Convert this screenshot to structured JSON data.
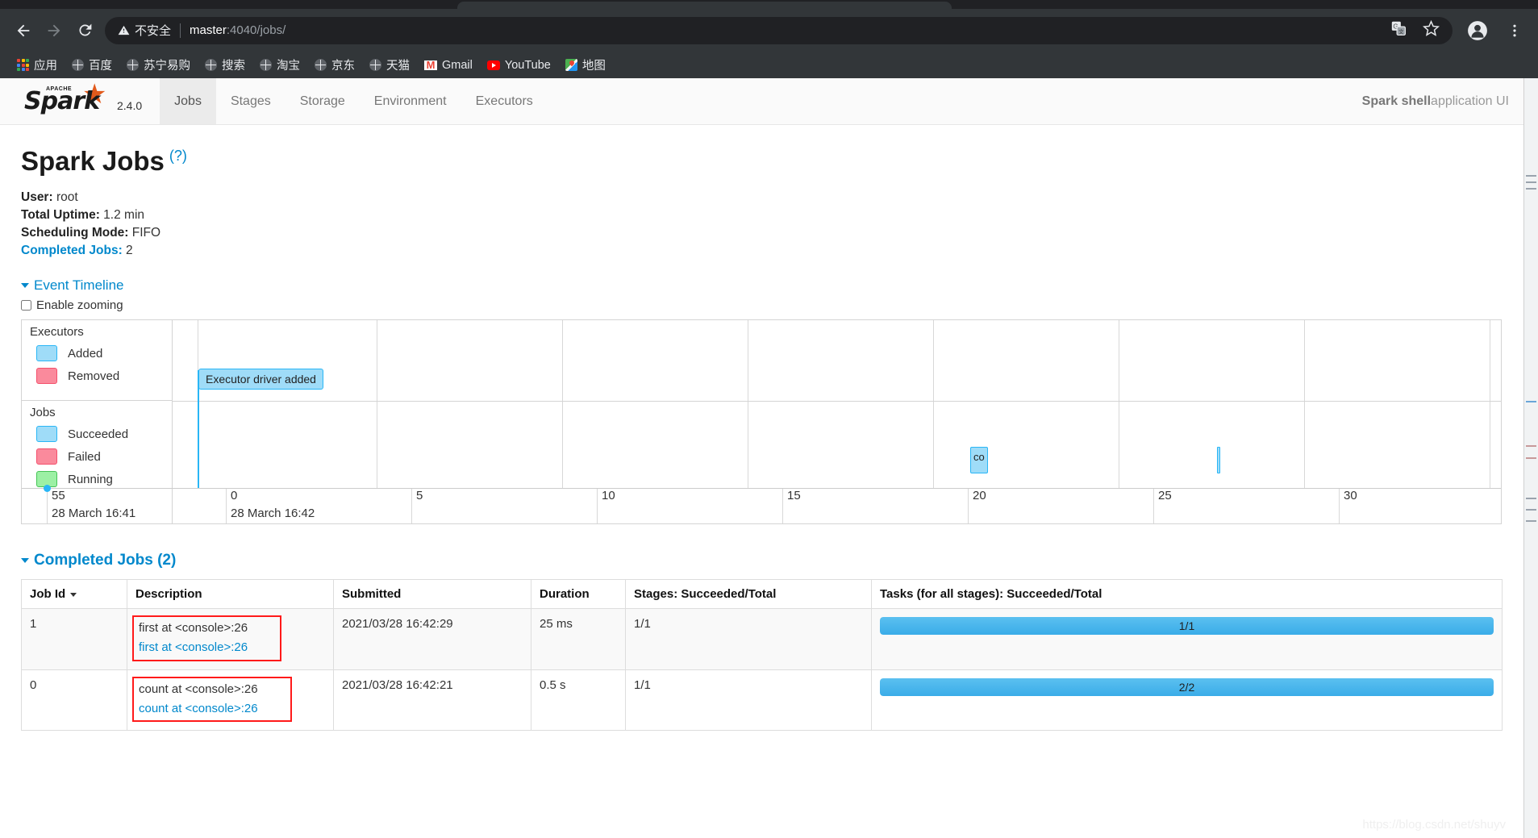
{
  "browser": {
    "back_icon": "back-arrow-icon",
    "forward_icon": "forward-arrow-icon",
    "reload_icon": "reload-icon",
    "security_label": "不安全",
    "security_icon": "warning-triangle-icon",
    "url_host": "master",
    "url_rest": ":4040/jobs/",
    "url_full": "master:4040/jobs/",
    "translate_icon": "translate-icon",
    "bookmark_icon": "star-icon",
    "profile_icon": "account-avatar-icon",
    "menu_icon": "three-dot-menu-icon",
    "bookmarks": [
      {
        "label": "应用",
        "icon": "apps-grid-icon"
      },
      {
        "label": "百度",
        "icon": "globe-icon"
      },
      {
        "label": "苏宁易购",
        "icon": "globe-icon"
      },
      {
        "label": "搜索",
        "icon": "globe-icon"
      },
      {
        "label": "淘宝",
        "icon": "globe-icon"
      },
      {
        "label": "京东",
        "icon": "globe-icon"
      },
      {
        "label": "天猫",
        "icon": "globe-icon"
      },
      {
        "label": "Gmail",
        "icon": "gmail-icon"
      },
      {
        "label": "YouTube",
        "icon": "youtube-icon"
      },
      {
        "label": "地图",
        "icon": "maps-icon"
      }
    ]
  },
  "spark_nav": {
    "brand_word": "Spark",
    "brand_tag": "APACHE",
    "version": "2.4.0",
    "tabs": [
      {
        "label": "Jobs",
        "active": true
      },
      {
        "label": "Stages",
        "active": false
      },
      {
        "label": "Storage",
        "active": false
      },
      {
        "label": "Environment",
        "active": false
      },
      {
        "label": "Executors",
        "active": false
      }
    ],
    "app_title_bold": "Spark shell",
    "app_title_rest": " application UI"
  },
  "page": {
    "title": "Spark Jobs",
    "help_link": "(?)",
    "summary": [
      {
        "label": "User:",
        "value": " root",
        "is_link": false
      },
      {
        "label": "Total Uptime:",
        "value": " 1.2 min",
        "is_link": false
      },
      {
        "label": "Scheduling Mode:",
        "value": " FIFO",
        "is_link": false
      },
      {
        "label": "Completed Jobs:",
        "value": " 2",
        "is_link": true
      }
    ],
    "event_timeline_label": "Event Timeline",
    "enable_zooming_label": "Enable zooming",
    "watermark": "https://blog.csdn.net/shuyv"
  },
  "timeline": {
    "legend": {
      "executors_title": "Executors",
      "executors_items": [
        {
          "label": "Added",
          "color": "#9fdcf8"
        },
        {
          "label": "Removed",
          "color": "#fa8a9c"
        }
      ],
      "jobs_title": "Jobs",
      "jobs_items": [
        {
          "label": "Succeeded",
          "color": "#9fdcf8"
        },
        {
          "label": "Failed",
          "color": "#fa8a9c"
        },
        {
          "label": "Running",
          "color": "#9cf0a4"
        }
      ]
    },
    "events": [
      {
        "label": "Executor driver added",
        "type": "executor-added"
      },
      {
        "label": "co",
        "type": "job-succeeded"
      },
      {
        "label": "",
        "type": "job-succeeded"
      }
    ],
    "axis_ticks": [
      {
        "num": "55",
        "date": "28 March 16:41"
      },
      {
        "num": "0",
        "date": "28 March 16:42"
      },
      {
        "num": "5",
        "date": ""
      },
      {
        "num": "10",
        "date": ""
      },
      {
        "num": "15",
        "date": ""
      },
      {
        "num": "20",
        "date": ""
      },
      {
        "num": "25",
        "date": ""
      },
      {
        "num": "30",
        "date": ""
      }
    ]
  },
  "jobs_section": {
    "heading": "Completed Jobs (2)",
    "columns": [
      "Job Id",
      "Description",
      "Submitted",
      "Duration",
      "Stages: Succeeded/Total",
      "Tasks (for all stages): Succeeded/Total"
    ],
    "rows": [
      {
        "job_id": "1",
        "desc_main": "first at <console>:26",
        "desc_link": "first at <console>:26",
        "submitted": "2021/03/28 16:42:29",
        "duration": "25 ms",
        "stages": "1/1",
        "tasks_text": "1/1",
        "tasks_pct": 100
      },
      {
        "job_id": "0",
        "desc_main": "count at <console>:26",
        "desc_link": "count at <console>:26",
        "submitted": "2021/03/28 16:42:21",
        "duration": "0.5 s",
        "stages": "1/1",
        "tasks_text": "2/2",
        "tasks_pct": 100
      }
    ]
  },
  "colors": {
    "accent_blue": "#0088cc",
    "progress_blue": "#4fb3e8",
    "highlight_red": "#ff1a1a",
    "spark_orange": "#e25a1c"
  }
}
